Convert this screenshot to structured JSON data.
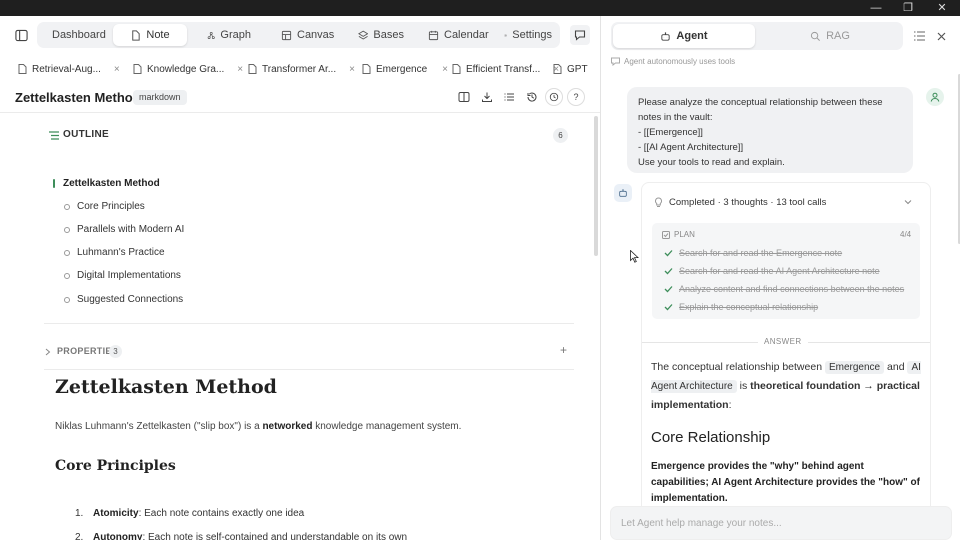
{
  "nav": {
    "tabs": [
      {
        "label": "Dashboard",
        "icon": "chart-icon"
      },
      {
        "label": "Note",
        "icon": "note-icon"
      },
      {
        "label": "Graph",
        "icon": "graph-icon"
      },
      {
        "label": "Canvas",
        "icon": "canvas-icon"
      },
      {
        "label": "Bases",
        "icon": "layers-icon"
      },
      {
        "label": "Calendar",
        "icon": "calendar-icon"
      },
      {
        "label": "Settings",
        "icon": "gear-icon"
      }
    ],
    "active": "Note"
  },
  "file_tabs": [
    "Retrieval-Aug...",
    "Knowledge Gra...",
    "Transformer Ar...",
    "Emergence",
    "Efficient Transf...",
    "GPT"
  ],
  "doc": {
    "title": "Zettelkasten Method",
    "tag": "markdown"
  },
  "outline": {
    "label": "OUTLINE",
    "count": "6",
    "main": "Zettelkasten Method",
    "items": [
      "Core Principles",
      "Parallels with Modern AI",
      "Luhmann's Practice",
      "Digital Implementations",
      "Suggested Connections"
    ]
  },
  "properties": {
    "label": "PROPERTIES",
    "count": "3"
  },
  "content": {
    "h1": "Zettelkasten Method",
    "para_before": "Niklas Luhmann's Zettelkasten (\"slip box\") is a ",
    "para_bold": "networked",
    "para_after": " knowledge management system.",
    "h2": "Core Principles",
    "list": [
      {
        "num": "1.",
        "bold": "Atomicity",
        "text": ": Each note contains exactly one idea"
      },
      {
        "num": "2.",
        "bold": "Autonomy",
        "text": ": Each note is self-contained and understandable on its own"
      }
    ]
  },
  "agent_panel": {
    "tab_agent": "Agent",
    "tab_rag": "RAG",
    "subtitle": "Agent autonomously uses tools",
    "user_message": [
      "Please analyze the conceptual relationship between these notes in the vault:",
      "- [[Emergence]]",
      "- [[AI Agent Architecture]]",
      "Use your tools to read and explain."
    ],
    "status": "Completed · 3 thoughts · 13 tool calls",
    "plan_label": "PLAN",
    "plan_count": "4/4",
    "plan_items": [
      "Search for and read the Emergence note",
      "Search for and read the AI Agent Architecture note",
      "Analyze content and find connections between the notes",
      "Explain the conceptual relationship"
    ],
    "answer_label": "ANSWER",
    "answer_intro_1": "The conceptual relationship between ",
    "answer_chip_1": "Emergence",
    "answer_intro_2": " and ",
    "answer_chip_2": "AI Agent Architecture",
    "answer_intro_3": " is ",
    "answer_bold": "theoretical foundation → practical implementation",
    "answer_intro_4": ":",
    "answer_heading": "Core Relationship",
    "answer_bold_para": "Emergence provides the \"why\" behind agent capabilities; AI Agent Architecture provides the \"how\" of implementation.",
    "input_placeholder": "Let Agent help manage your notes..."
  },
  "colors": {
    "accent_green": "#3e8e5b",
    "titlebar": "#1f1f1f"
  }
}
